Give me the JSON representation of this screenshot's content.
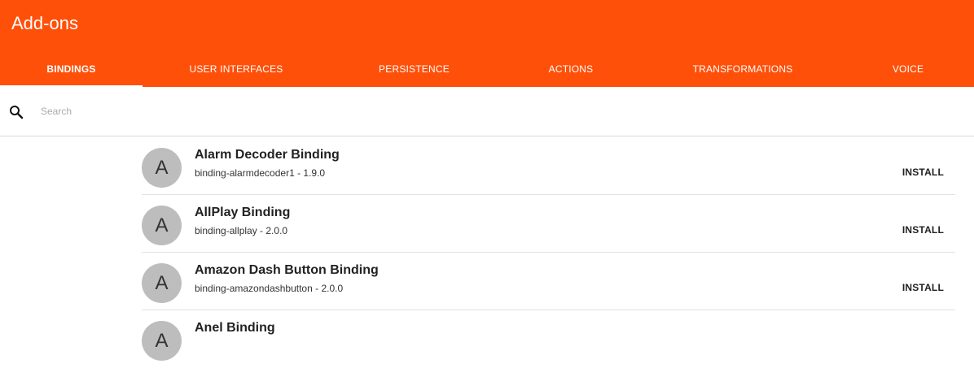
{
  "app": {
    "title": "Add-ons",
    "accent_color": "#ff5009"
  },
  "tabs": [
    {
      "label": "BINDINGS",
      "active": true
    },
    {
      "label": "USER INTERFACES",
      "active": false
    },
    {
      "label": "PERSISTENCE",
      "active": false
    },
    {
      "label": "ACTIONS",
      "active": false
    },
    {
      "label": "TRANSFORMATIONS",
      "active": false
    },
    {
      "label": "VOICE",
      "active": false
    }
  ],
  "search": {
    "placeholder": "Search",
    "value": "",
    "icon": "search-icon"
  },
  "addons": [
    {
      "avatar_letter": "A",
      "title": "Alarm Decoder Binding",
      "subtitle": "binding-alarmdecoder1 - 1.9.0",
      "action": "INSTALL"
    },
    {
      "avatar_letter": "A",
      "title": "AllPlay Binding",
      "subtitle": "binding-allplay - 2.0.0",
      "action": "INSTALL"
    },
    {
      "avatar_letter": "A",
      "title": "Amazon Dash Button Binding",
      "subtitle": "binding-amazondashbutton - 2.0.0",
      "action": "INSTALL"
    },
    {
      "avatar_letter": "A",
      "title": "Anel Binding",
      "subtitle": "",
      "action": ""
    }
  ]
}
